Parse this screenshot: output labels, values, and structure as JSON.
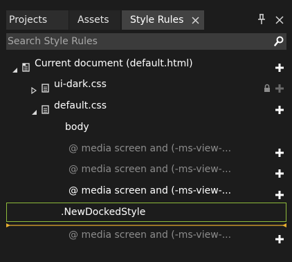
{
  "tabs": {
    "projects": "Projects",
    "assets": "Assets",
    "style_rules": "Style Rules"
  },
  "search": {
    "placeholder": "Search Style Rules"
  },
  "tree": {
    "current_document": "Current document (default.html)",
    "ui_dark": "ui-dark.css",
    "default_css": "default.css",
    "body": "body",
    "media1": "@ media screen and (-ms-view-...",
    "media2": "@ media screen and (-ms-view-...",
    "media3": "@ media screen and (-ms-view-...",
    "new_docked": ".NewDockedStyle",
    "media4": "@ media screen and (-ms-view-..."
  },
  "colors": {
    "background": "#1c1c1c",
    "active_tab": "#424242",
    "search_bg": "#3b3b3b",
    "selection_border": "#8fbc3b",
    "insertion_line": "#e8b030"
  }
}
